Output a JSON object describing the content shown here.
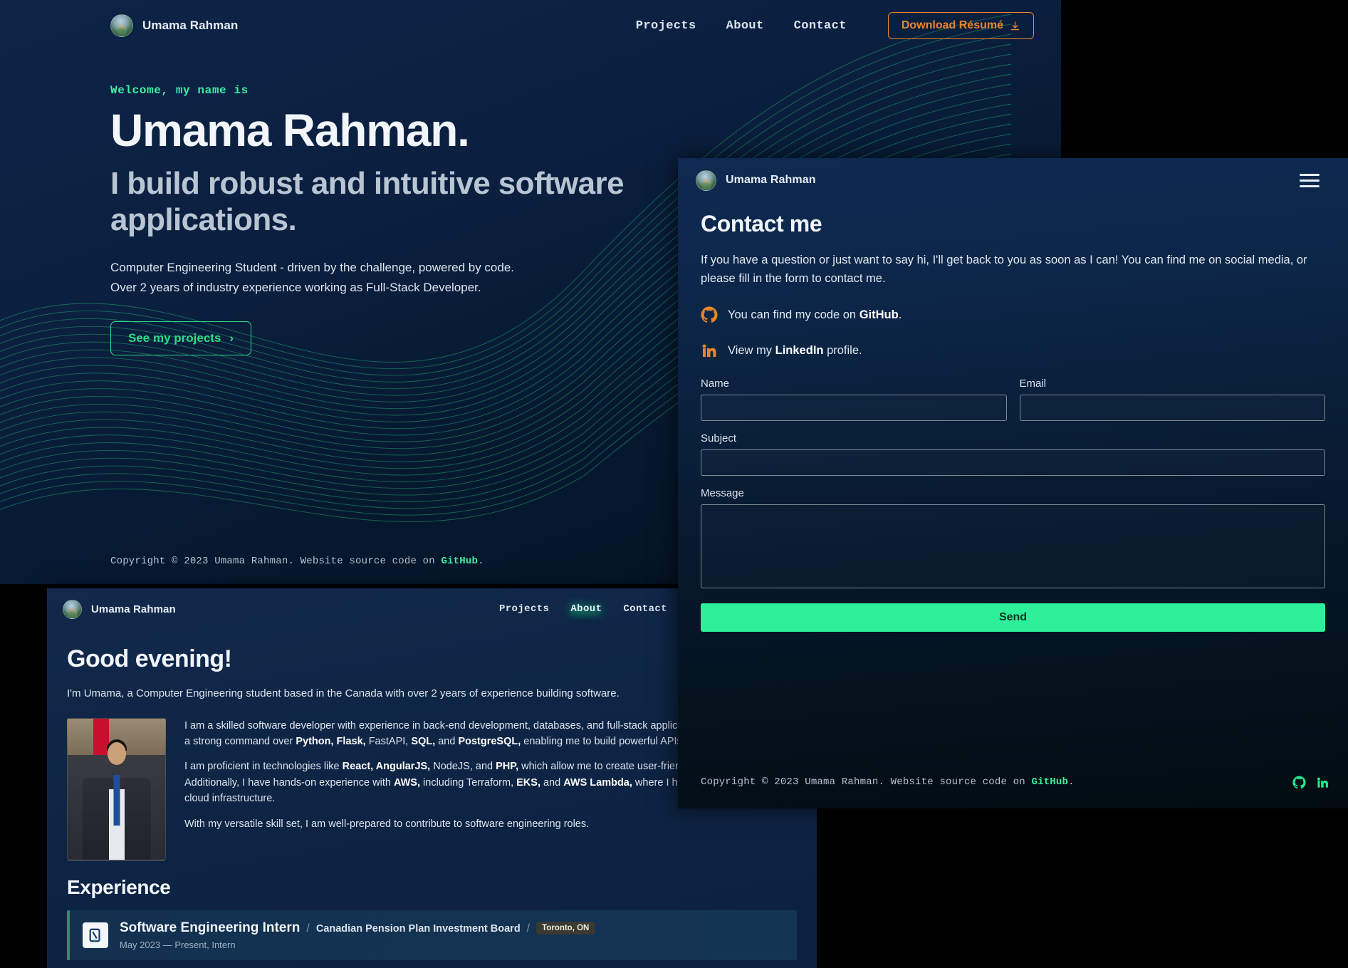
{
  "hero": {
    "brand_name": "Umama Rahman",
    "nav": [
      {
        "label": "Projects"
      },
      {
        "label": "About"
      },
      {
        "label": "Contact"
      }
    ],
    "resume_button": "Download Résumé",
    "eyebrow": "Welcome, my name is",
    "name": "Umama Rahman.",
    "tagline": "I build robust and intuitive software applications.",
    "desc_line1": "Computer Engineering Student - driven by the challenge, powered by code.",
    "desc_line2": "Over 2 years of industry experience working as Full-Stack Developer.",
    "projects_button": "See my projects",
    "chevron": "›",
    "footer_prefix": "Copyright © 2023 Umama Rahman. Website source code on ",
    "footer_link": "GitHub",
    "footer_suffix": "."
  },
  "about": {
    "brand_name": "Umama Rahman",
    "nav": [
      {
        "label": "Projects",
        "active": false
      },
      {
        "label": "About",
        "active": true
      },
      {
        "label": "Contact",
        "active": false
      }
    ],
    "greeting": "Good evening!",
    "intro": "I'm Umama, a Computer Engineering student based in the Canada with over 2 years of experience building software.",
    "para1_a": "I am a skilled software developer with experience in back-end development, databases, and full-stack application development. I have a strong command over ",
    "para1_b": "Python, Flask,",
    "para1_c": " FastAPI, ",
    "para1_d": "SQL,",
    "para1_e": " and ",
    "para1_f": "PostgreSQL,",
    "para1_g": " enabling me to build powerful APIs and services.",
    "para2_a": "I am proficient in technologies like ",
    "para2_b": "React, AngularJS,",
    "para2_c": " NodeJS, and ",
    "para2_d": "PHP,",
    "para2_e": " which allow me to create user-friendly interfaces. Additionally, I have hands-on experience with ",
    "para2_f": "AWS,",
    "para2_g": " including Terraform, ",
    "para2_h": "EKS,",
    "para2_i": " and ",
    "para2_j": "AWS Lambda,",
    "para2_k": " where I have successfully set up cloud infrastructure.",
    "para3": "With my versatile skill set, I am well-prepared to contribute to software engineering roles.",
    "experience_title": "Experience",
    "experience": [
      {
        "role": "Software Engineering Intern",
        "company": "Canadian Pension Plan Investment Board",
        "location": "Toronto, ON",
        "meta": "May 2023 — Present, Intern"
      }
    ]
  },
  "contact": {
    "brand_name": "Umama Rahman",
    "title": "Contact me",
    "paragraph": "If you have a question or just want to say hi, I'll get back to you as soon as I can! You can find me on social media, or please fill in the form to contact me.",
    "github_line_prefix": "You can find my code on ",
    "github_line_link": "GitHub",
    "github_line_suffix": ".",
    "linkedin_line_prefix": "View my ",
    "linkedin_line_link": "LinkedIn",
    "linkedin_line_suffix": " profile.",
    "fields": {
      "name_label": "Name",
      "name_value": "",
      "email_label": "Email",
      "email_value": "",
      "subject_label": "Subject",
      "subject_value": "",
      "message_label": "Message",
      "message_value": ""
    },
    "send_button": "Send",
    "footer_prefix": "Copyright © 2023 Umama Rahman. Website source code on ",
    "footer_link": "GitHub",
    "footer_suffix": "."
  },
  "colors": {
    "accent_green": "#2ef09a",
    "accent_orange": "#e8862b",
    "hero_bg": "#0b2040",
    "text_light": "#f2f6fa"
  }
}
